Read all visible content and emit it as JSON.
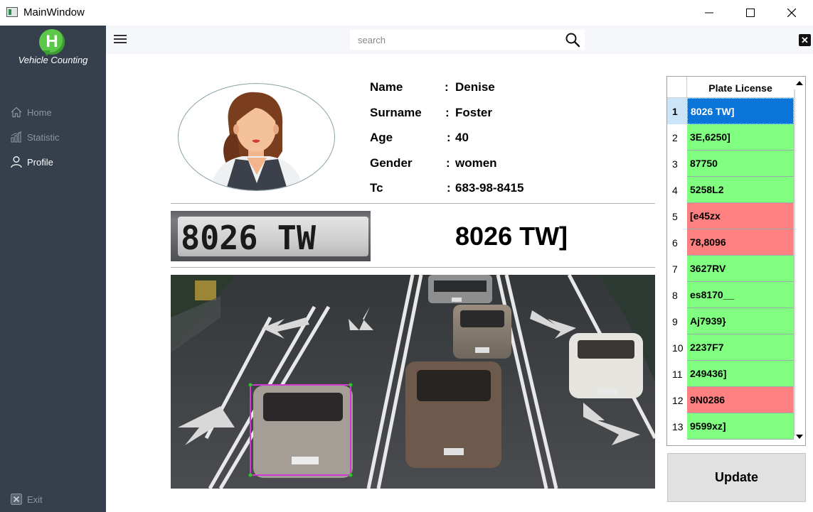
{
  "window": {
    "title": "MainWindow",
    "controls": {
      "minimize": "—",
      "maximize": "☐",
      "close": "✕"
    }
  },
  "sidebar": {
    "brand": "Vehicle Counting",
    "logo_letter": "H",
    "items": [
      {
        "label": "Home",
        "icon": "home-icon",
        "active": false
      },
      {
        "label": "Statistic",
        "icon": "bar-chart-icon",
        "active": false
      },
      {
        "label": "Profile",
        "icon": "user-icon",
        "active": true
      }
    ],
    "exit_label": "Exit"
  },
  "topbar": {
    "search_placeholder": "search",
    "close_glyph": "✕"
  },
  "profile": {
    "fields": [
      {
        "label": "Name",
        "value": "Denise"
      },
      {
        "label": "Surname",
        "value": "Foster"
      },
      {
        "label": "Age",
        "value": "40"
      },
      {
        "label": "Gender",
        "value": "women"
      },
      {
        "label": "Tc",
        "value": "683-98-8415"
      }
    ],
    "separator": ":"
  },
  "plate": {
    "image_text": "8026 TW",
    "recognized": "8026 TW]"
  },
  "scene": {
    "detected_plate": "8026 TW",
    "box_color": "#d238d2",
    "corner_color": "#22cc22"
  },
  "table": {
    "header": "Plate License",
    "rows": [
      {
        "num": "1",
        "value": "8026 TW]",
        "status": "selected"
      },
      {
        "num": "2",
        "value": "3E,6250]",
        "status": "valid"
      },
      {
        "num": "3",
        "value": "87750",
        "status": "valid"
      },
      {
        "num": "4",
        "value": "5258L2",
        "status": "valid"
      },
      {
        "num": "5",
        "value": "[e45zx",
        "status": "invalid"
      },
      {
        "num": "6",
        "value": "78,8096",
        "status": "invalid"
      },
      {
        "num": "7",
        "value": "3627RV",
        "status": "valid"
      },
      {
        "num": "8",
        "value": "es8170__",
        "status": "valid"
      },
      {
        "num": "9",
        "value": "Aj7939}",
        "status": "valid"
      },
      {
        "num": "10",
        "value": "2237F7",
        "status": "valid"
      },
      {
        "num": "11",
        "value": "249436]",
        "status": "valid"
      },
      {
        "num": "12",
        "value": "9N0286",
        "status": "invalid"
      },
      {
        "num": "13",
        "value": "9599xz]",
        "status": "valid"
      }
    ],
    "colors": {
      "valid": "#80ff80",
      "invalid": "#ff8080",
      "selected": "#0a74d8"
    }
  },
  "update_label": "Update"
}
